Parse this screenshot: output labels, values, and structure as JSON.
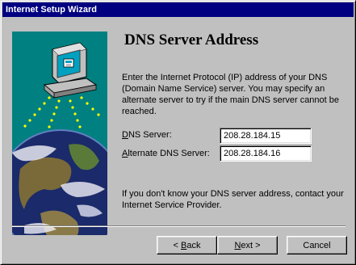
{
  "window": {
    "title": "Internet Setup Wizard"
  },
  "page": {
    "heading": "DNS Server Address",
    "intro": "Enter the Internet Protocol (IP) address of your DNS (Domain Name Service) server.  You may specify an alternate server to try if the main DNS server cannot be reached.",
    "footer_note": "If you don't know your DNS server address, contact your Internet Service Provider."
  },
  "fields": {
    "dns": {
      "label_mnemonic": "D",
      "label_rest": "NS Server:",
      "value": "208.28.184.15"
    },
    "alternate": {
      "label_mnemonic": "A",
      "label_rest": "lternate DNS Server:",
      "value": "208.28.184.16"
    }
  },
  "buttons": {
    "back_prefix": "< ",
    "back_mnemonic": "B",
    "back_rest": "ack",
    "next_mnemonic": "N",
    "next_rest": "ext >",
    "cancel": "Cancel"
  },
  "colors": {
    "title_bar": "#000080",
    "art_background": "#008080",
    "dialog_face": "#c0c0c0"
  },
  "icons": [
    "computer-icon",
    "globe-icon"
  ]
}
